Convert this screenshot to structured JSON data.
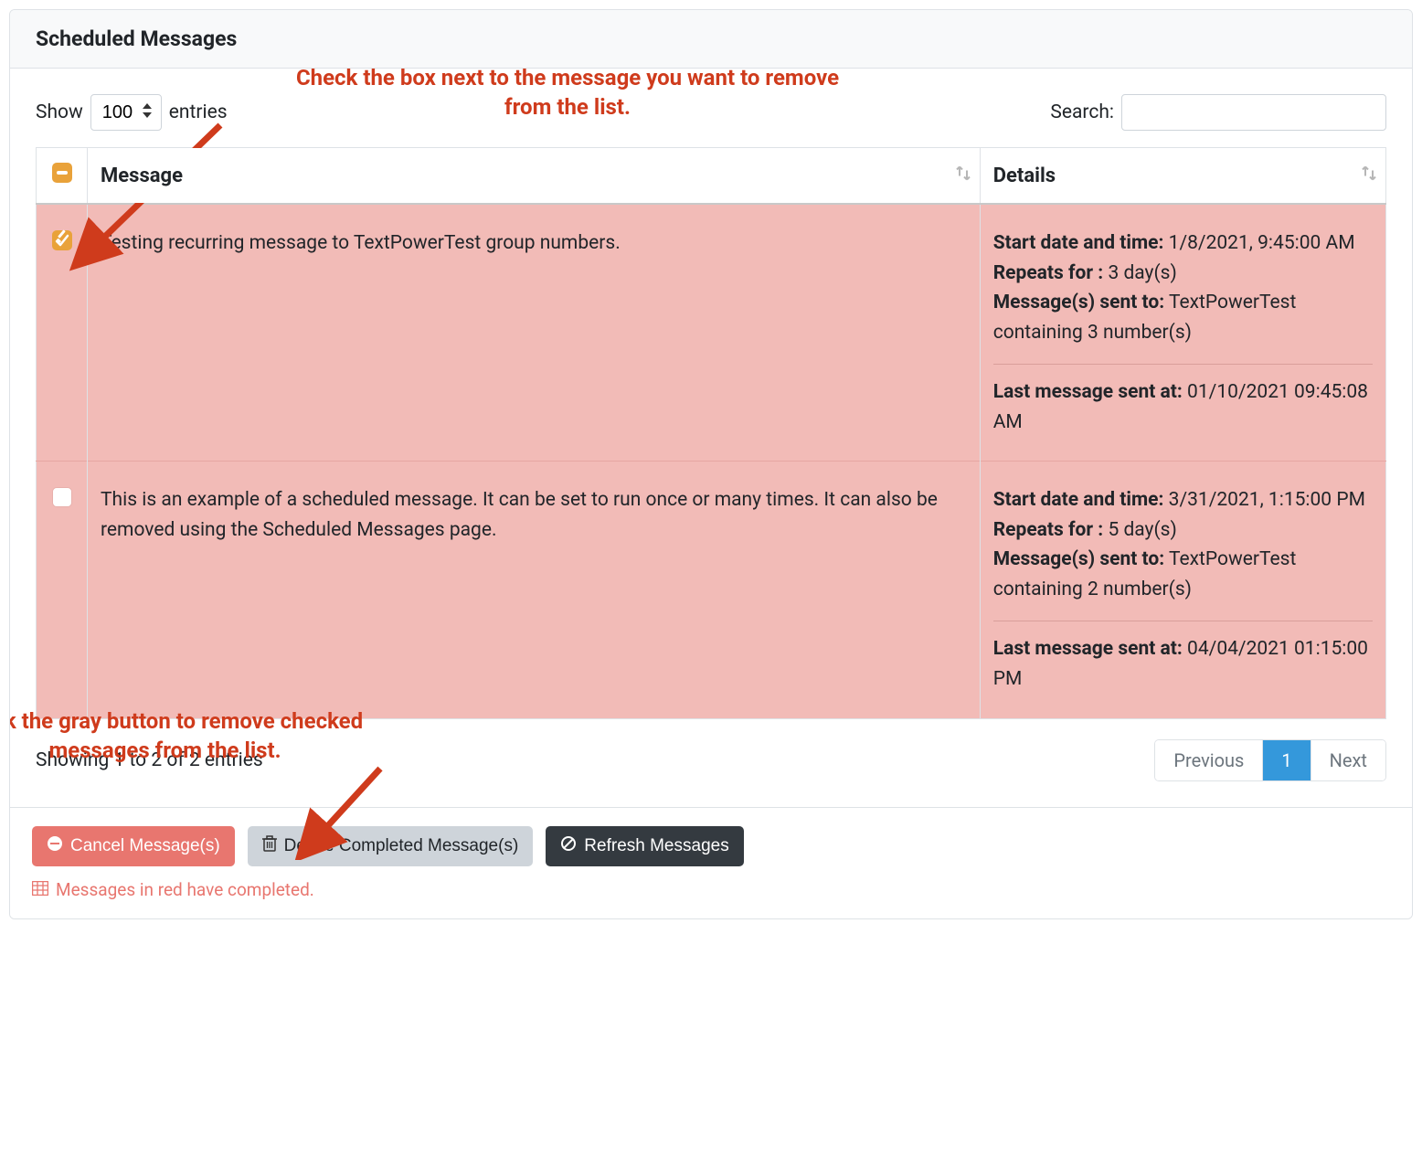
{
  "header": {
    "title": "Scheduled Messages"
  },
  "length": {
    "show": "Show",
    "value": "100",
    "entries": "entries"
  },
  "search": {
    "label": "Search:",
    "placeholder": ""
  },
  "columns": {
    "message": "Message",
    "details": "Details"
  },
  "rows": [
    {
      "checked": true,
      "message": "Testing recurring message to TextPowerTest group numbers.",
      "start_label": "Start date and time:",
      "start_value": "1/8/2021, 9:45:00 AM",
      "repeats_label": "Repeats for :",
      "repeats_value": "3 day(s)",
      "sent_to_label": "Message(s) sent to:",
      "sent_to_value": "TextPowerTest containing 3 number(s)",
      "last_label": "Last message sent at:",
      "last_value": "01/10/2021 09:45:08 AM"
    },
    {
      "checked": false,
      "message": "This is an example of a scheduled message. It can be set to run once or many times. It can also be removed using the Scheduled Messages page.",
      "start_label": "Start date and time:",
      "start_value": "3/31/2021, 1:15:00 PM",
      "repeats_label": "Repeats for :",
      "repeats_value": "5 day(s)",
      "sent_to_label": "Message(s) sent to:",
      "sent_to_value": "TextPowerTest containing 2 number(s)",
      "last_label": "Last message sent at:",
      "last_value": "04/04/2021 01:15:00 PM"
    }
  ],
  "info": "Showing 1 to 2 of 2 entries",
  "pagination": {
    "prev": "Previous",
    "page": "1",
    "next": "Next"
  },
  "buttons": {
    "cancel": "Cancel Message(s)",
    "delete": "Delete Completed Message(s)",
    "refresh": "Refresh Messages"
  },
  "legend": "Messages in red have completed.",
  "annotations": {
    "top": "Check the box next to the message you want to remove from the list.",
    "bottom": "Click the gray button to remove checked messages from the list."
  }
}
